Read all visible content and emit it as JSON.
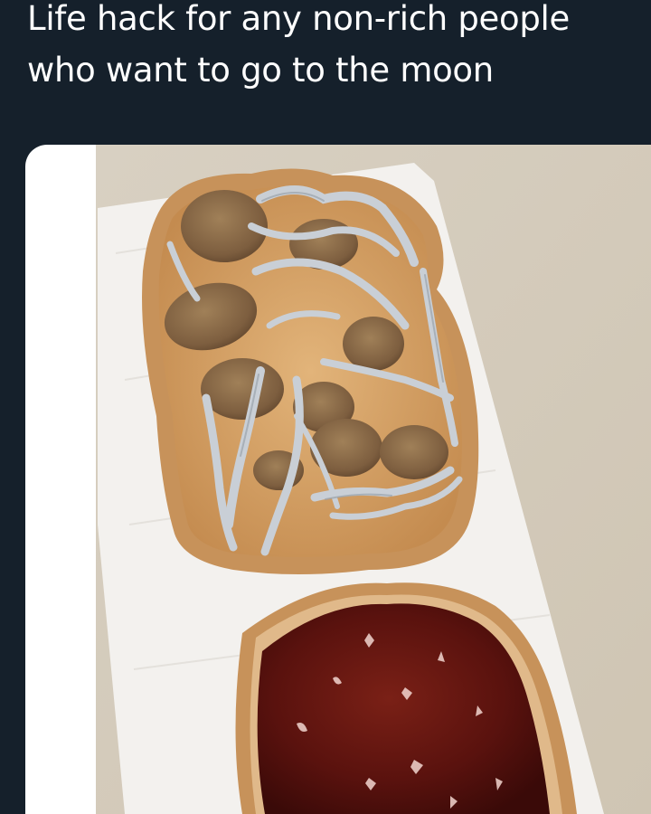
{
  "post": {
    "caption_line_1": "Life hack for any non-rich people",
    "caption_line_2": "who want to go to the moon"
  },
  "colors": {
    "background": "#15202b",
    "caption_text": "#ffffff",
    "countertop": "#d6cdbd",
    "bread_crust": "#c7925a",
    "peanut_butter": "#d9a76b",
    "mushroom_cap": "#8a6a48",
    "mushroom_stem": "#c9cfd6",
    "jelly": "#5c1410"
  }
}
